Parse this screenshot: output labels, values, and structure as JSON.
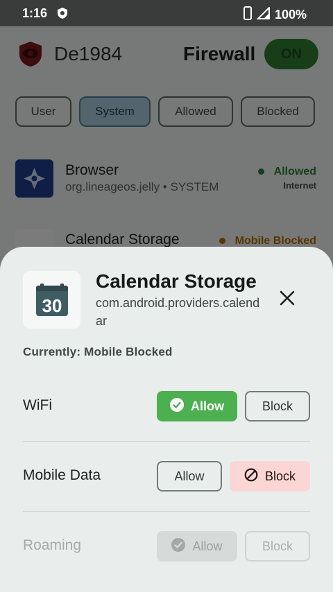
{
  "status_bar": {
    "time": "1:16",
    "battery": "100%"
  },
  "header": {
    "app_name": "De1984",
    "firewall_label": "Firewall",
    "toggle_label": "ON"
  },
  "filters": [
    {
      "label": "User",
      "active": false
    },
    {
      "label": "System",
      "active": true
    },
    {
      "label": "Allowed",
      "active": false
    },
    {
      "label": "Blocked",
      "active": false
    }
  ],
  "apps": [
    {
      "name": "Browser",
      "package": "org.lineageos.jelly • SYSTEM",
      "state": "Allowed",
      "sub": "Internet",
      "state_color": "#2e7d32"
    },
    {
      "name": "Calendar Storage",
      "package": "",
      "state": "Mobile Blocked",
      "sub": "",
      "state_color": "#b36b00"
    }
  ],
  "sheet": {
    "title": "Calendar Storage",
    "package": "com.android.providers.calendar",
    "currently": "Currently: Mobile Blocked",
    "icon_text": "30",
    "rows": [
      {
        "label": "WiFi",
        "allow": "Allow",
        "block": "Block"
      },
      {
        "label": "Mobile Data",
        "allow": "Allow",
        "block": "Block"
      },
      {
        "label": "Roaming",
        "allow": "Allow",
        "block": "Block"
      }
    ]
  },
  "colors": {
    "allow_green": "#4caf50",
    "block_red": "#fbd6d4",
    "toggle_on": "#2e7d32"
  }
}
